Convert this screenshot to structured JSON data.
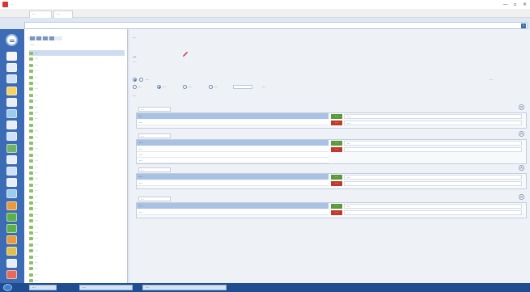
{
  "window": {
    "title": "···",
    "min_glyph": "—",
    "max_glyph": "▫",
    "close_glyph": "✕"
  },
  "tabs": [
    {
      "label": "···"
    },
    {
      "label": "···"
    }
  ],
  "address": {
    "value": "",
    "go_glyph": "›"
  },
  "tree": {
    "root_label": "···",
    "items": [
      {
        "label": "···",
        "selected": true
      },
      {
        "label": "···"
      },
      {
        "label": "···"
      },
      {
        "label": "···"
      },
      {
        "label": "···"
      },
      {
        "label": "···"
      },
      {
        "label": "···"
      },
      {
        "label": "···"
      },
      {
        "label": "···"
      },
      {
        "label": "···"
      },
      {
        "label": "···"
      },
      {
        "label": "···"
      },
      {
        "label": "···"
      },
      {
        "label": "···"
      },
      {
        "label": "···"
      },
      {
        "label": "···"
      },
      {
        "label": "···"
      },
      {
        "label": "···"
      },
      {
        "label": "···"
      },
      {
        "label": "···"
      },
      {
        "label": "···"
      },
      {
        "label": "···"
      },
      {
        "label": "···"
      },
      {
        "label": "···"
      },
      {
        "label": "···"
      },
      {
        "label": "···"
      },
      {
        "label": "···"
      },
      {
        "label": "···"
      },
      {
        "label": "···"
      },
      {
        "label": "···"
      },
      {
        "label": "···"
      },
      {
        "label": "···"
      },
      {
        "label": "···"
      },
      {
        "label": "···"
      },
      {
        "label": "···"
      },
      {
        "label": "···"
      },
      {
        "label": "···"
      },
      {
        "label": "···"
      },
      {
        "label": "···"
      }
    ]
  },
  "main": {
    "breadcrumb": "···",
    "prop_title": "···",
    "prop_subtitle": "···",
    "option_row1": "···",
    "option_row2": [
      "···",
      "···",
      "···",
      "···",
      "···"
    ],
    "option_label3": "···",
    "right_link": "···",
    "cards": [
      {
        "label": "···",
        "head": "···",
        "left_rows": [
          "···"
        ],
        "ok_badge": "···",
        "err_badge": "···",
        "ok_text": "···",
        "err_text": "···"
      },
      {
        "label": "···",
        "head": "···",
        "left_rows": [
          "···",
          "···",
          "···"
        ],
        "ok_badge": "···",
        "err_badge": "···",
        "ok_text": "···",
        "err_text": "···"
      },
      {
        "label": "···",
        "head": "···",
        "left_rows": [
          "···"
        ],
        "ok_badge": "···",
        "err_badge": "···",
        "ok_text": "···",
        "err_text": "···"
      },
      {
        "label": "···",
        "head": "···",
        "left_rows": [
          "···"
        ],
        "ok_badge": "···",
        "err_badge": "···",
        "ok_text": "···",
        "err_text": "···"
      }
    ]
  },
  "taskbar": {
    "buttons": [
      {
        "label": "···"
      },
      {
        "label": "···"
      },
      {
        "label": "···"
      }
    ]
  },
  "colors": {
    "toolbar_blue": "#3b6cb5",
    "card_head": "#a9c1e3",
    "ok_green": "#5a9a3c",
    "err_red": "#c0392b",
    "taskbar": "#1f4d8f"
  },
  "icons": {
    "app": "app-icon",
    "edit": "pencil-icon",
    "toolbar": [
      "menu-icon",
      "doc-icon",
      "save-icon",
      "folder-icon",
      "print-icon",
      "mail-icon",
      "search-icon",
      "grid-icon",
      "chart-icon",
      "user-icon",
      "table-icon",
      "settings-icon",
      "gear-icon",
      "tag-icon",
      "check-icon",
      "check-icon",
      "flag-icon",
      "warning-icon",
      "help-icon",
      "exit-icon"
    ]
  }
}
